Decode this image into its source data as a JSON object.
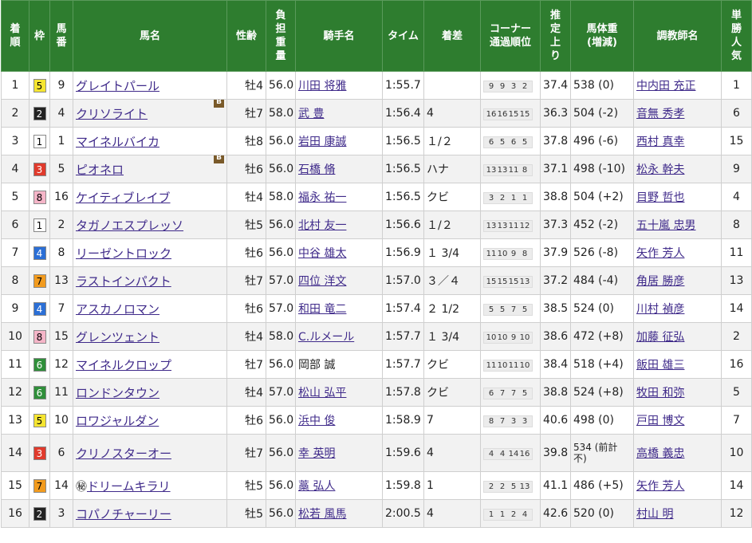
{
  "headers": [
    "着\n順",
    "枠",
    "馬\n番",
    "馬名",
    "性齢",
    "負\n担\n重\n量",
    "騎手名",
    "タイム",
    "着差",
    "コーナー\n通過順位",
    "推\n定\n上\nり",
    "馬体重\n(増減)",
    "調教師名",
    "単\n勝\n人\n気"
  ],
  "waku_colors": {
    "1": {
      "bg": "#ffffff",
      "fg": "#000000"
    },
    "2": {
      "bg": "#222222",
      "fg": "#ffffff"
    },
    "3": {
      "bg": "#e03a2c",
      "fg": "#ffffff"
    },
    "4": {
      "bg": "#2b6fd6",
      "fg": "#ffffff"
    },
    "5": {
      "bg": "#f5e531",
      "fg": "#000000"
    },
    "6": {
      "bg": "#2f8f3a",
      "fg": "#ffffff"
    },
    "7": {
      "bg": "#f29b1e",
      "fg": "#000000"
    },
    "8": {
      "bg": "#f5b5c8",
      "fg": "#000000"
    }
  },
  "rows": [
    {
      "rank": "1",
      "waku": "5",
      "num": "9",
      "horse": "グレイトパール",
      "badge": "",
      "sexage": "牡4",
      "weight": "56.0",
      "jockey": "川田 将雅",
      "jockey_link": true,
      "time": "1:55.7",
      "margin": "",
      "corner": [
        "9",
        "9",
        "3",
        "2"
      ],
      "last3f": "37.4",
      "bodyweight": "538 (0)",
      "trainer": "中内田 充正",
      "pop": "1"
    },
    {
      "rank": "2",
      "waku": "2",
      "num": "4",
      "horse": "クリソライト",
      "badge": "B",
      "sexage": "牡7",
      "weight": "58.0",
      "jockey": "武 豊",
      "jockey_link": true,
      "time": "1:56.4",
      "margin": "4",
      "corner": [
        "16",
        "16",
        "15",
        "15"
      ],
      "last3f": "36.3",
      "bodyweight": "504 (-2)",
      "trainer": "音無 秀孝",
      "pop": "6"
    },
    {
      "rank": "3",
      "waku": "1",
      "num": "1",
      "horse": "マイネルバイカ",
      "badge": "",
      "sexage": "牡8",
      "weight": "56.0",
      "jockey": "岩田 康誠",
      "jockey_link": true,
      "time": "1:56.5",
      "margin": "１/２",
      "corner": [
        "6",
        "5",
        "6",
        "5"
      ],
      "last3f": "37.8",
      "bodyweight": "496 (-6)",
      "trainer": "西村 真幸",
      "pop": "15"
    },
    {
      "rank": "4",
      "waku": "3",
      "num": "5",
      "horse": "ピオネロ",
      "badge": "B",
      "sexage": "牡6",
      "weight": "56.0",
      "jockey": "石橋 脩",
      "jockey_link": true,
      "time": "1:56.5",
      "margin": "ハナ",
      "corner": [
        "13",
        "13",
        "11",
        "8"
      ],
      "last3f": "37.1",
      "bodyweight": "498 (-10)",
      "trainer": "松永 幹夫",
      "pop": "9"
    },
    {
      "rank": "5",
      "waku": "8",
      "num": "16",
      "horse": "ケイティブレイブ",
      "badge": "",
      "sexage": "牡4",
      "weight": "58.0",
      "jockey": "福永 祐一",
      "jockey_link": true,
      "time": "1:56.5",
      "margin": "クビ",
      "corner": [
        "3",
        "2",
        "1",
        "1"
      ],
      "last3f": "38.8",
      "bodyweight": "504 (+2)",
      "trainer": "目野 哲也",
      "pop": "4"
    },
    {
      "rank": "6",
      "waku": "1",
      "num": "2",
      "horse": "タガノエスプレッソ",
      "badge": "",
      "sexage": "牡5",
      "weight": "56.0",
      "jockey": "北村 友一",
      "jockey_link": true,
      "time": "1:56.6",
      "margin": "１/２",
      "corner": [
        "13",
        "13",
        "11",
        "12"
      ],
      "last3f": "37.3",
      "bodyweight": "452 (-2)",
      "trainer": "五十嵐 忠男",
      "pop": "8"
    },
    {
      "rank": "7",
      "waku": "4",
      "num": "8",
      "horse": "リーゼントロック",
      "badge": "",
      "sexage": "牡6",
      "weight": "56.0",
      "jockey": "中谷 雄太",
      "jockey_link": true,
      "time": "1:56.9",
      "margin": "１ 3/4",
      "corner": [
        "11",
        "10",
        "9",
        "8"
      ],
      "last3f": "37.9",
      "bodyweight": "526 (-8)",
      "trainer": "矢作 芳人",
      "pop": "11"
    },
    {
      "rank": "8",
      "waku": "7",
      "num": "13",
      "horse": "ラストインパクト",
      "badge": "",
      "sexage": "牡7",
      "weight": "57.0",
      "jockey": "四位 洋文",
      "jockey_link": true,
      "time": "1:57.0",
      "margin": "３／４",
      "corner": [
        "15",
        "15",
        "15",
        "13"
      ],
      "last3f": "37.2",
      "bodyweight": "484 (-4)",
      "trainer": "角居 勝彦",
      "pop": "13"
    },
    {
      "rank": "9",
      "waku": "4",
      "num": "7",
      "horse": "アスカノロマン",
      "badge": "",
      "sexage": "牡6",
      "weight": "57.0",
      "jockey": "和田 竜二",
      "jockey_link": true,
      "time": "1:57.4",
      "margin": "２ 1/2",
      "corner": [
        "5",
        "5",
        "7",
        "5"
      ],
      "last3f": "38.5",
      "bodyweight": "524 (0)",
      "trainer": "川村 禎彦",
      "pop": "14"
    },
    {
      "rank": "10",
      "waku": "8",
      "num": "15",
      "horse": "グレンツェント",
      "badge": "",
      "sexage": "牡4",
      "weight": "58.0",
      "jockey": "C.ルメール",
      "jockey_link": true,
      "time": "1:57.7",
      "margin": "１ 3/4",
      "corner": [
        "10",
        "10",
        "9",
        "10"
      ],
      "last3f": "38.6",
      "bodyweight": "472 (+8)",
      "trainer": "加藤 征弘",
      "pop": "2"
    },
    {
      "rank": "11",
      "waku": "6",
      "num": "12",
      "horse": "マイネルクロップ",
      "badge": "",
      "sexage": "牡7",
      "weight": "56.0",
      "jockey": "岡部 誠",
      "jockey_link": false,
      "time": "1:57.7",
      "margin": "クビ",
      "corner": [
        "11",
        "10",
        "11",
        "10"
      ],
      "last3f": "38.4",
      "bodyweight": "518 (+4)",
      "trainer": "飯田 雄三",
      "pop": "16"
    },
    {
      "rank": "12",
      "waku": "6",
      "num": "11",
      "horse": "ロンドンタウン",
      "badge": "",
      "sexage": "牡4",
      "weight": "57.0",
      "jockey": "松山 弘平",
      "jockey_link": true,
      "time": "1:57.8",
      "margin": "クビ",
      "corner": [
        "6",
        "7",
        "7",
        "5"
      ],
      "last3f": "38.8",
      "bodyweight": "524 (+8)",
      "trainer": "牧田 和弥",
      "pop": "5"
    },
    {
      "rank": "13",
      "waku": "5",
      "num": "10",
      "horse": "ロワジャルダン",
      "badge": "",
      "sexage": "牡6",
      "weight": "56.0",
      "jockey": "浜中 俊",
      "jockey_link": true,
      "time": "1:58.9",
      "margin": "7",
      "corner": [
        "8",
        "7",
        "3",
        "3"
      ],
      "last3f": "40.6",
      "bodyweight": "498 (0)",
      "trainer": "戸田 博文",
      "pop": "7"
    },
    {
      "rank": "14",
      "waku": "3",
      "num": "6",
      "horse": "クリノスターオー",
      "badge": "",
      "sexage": "牡7",
      "weight": "56.0",
      "jockey": "幸 英明",
      "jockey_link": true,
      "time": "1:59.6",
      "margin": "4",
      "corner": [
        "4",
        "4",
        "14",
        "16"
      ],
      "last3f": "39.8",
      "bodyweight": "534 (前計不)",
      "trainer": "高橋 義忠",
      "pop": "10",
      "tall": true
    },
    {
      "rank": "15",
      "waku": "7",
      "num": "14",
      "horse": "ドリームキラリ",
      "badge": "",
      "prefix": "㊙",
      "sexage": "牡5",
      "weight": "56.0",
      "jockey": "藁 弘人",
      "jockey_link": true,
      "time": "1:59.8",
      "margin": "1",
      "corner": [
        "2",
        "2",
        "5",
        "13"
      ],
      "last3f": "41.1",
      "bodyweight": "486 (+5)",
      "trainer": "矢作 芳人",
      "pop": "14"
    },
    {
      "rank": "16",
      "waku": "2",
      "num": "3",
      "horse": "コパノチャーリー",
      "badge": "",
      "sexage": "牡5",
      "weight": "56.0",
      "jockey": "松若 風馬",
      "jockey_link": true,
      "time": "2:00.5",
      "margin": "4",
      "corner": [
        "1",
        "1",
        "2",
        "4"
      ],
      "last3f": "42.6",
      "bodyweight": "520 (0)",
      "trainer": "村山 明",
      "pop": "12"
    }
  ]
}
